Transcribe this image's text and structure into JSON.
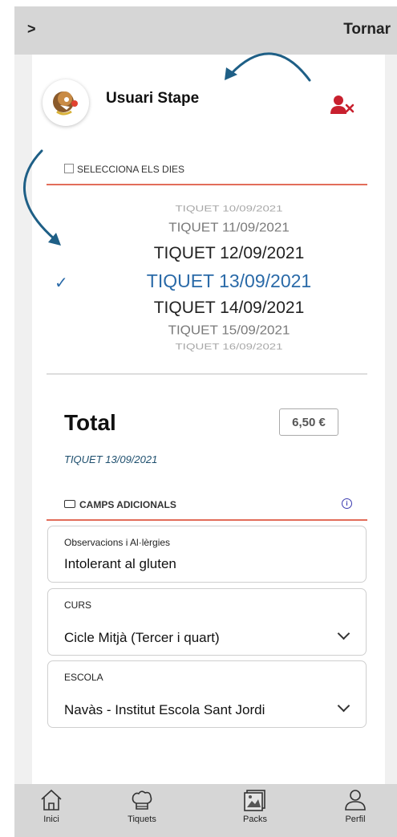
{
  "header": {
    "nav_glyph": ">",
    "back_label": "Tornar"
  },
  "user": {
    "name": "Usuari Stape"
  },
  "days_section": {
    "title": "SELECCIONA ELS DIES",
    "options": [
      "TIQUET 10/09/2021",
      "TIQUET 11/09/2021",
      "TIQUET 12/09/2021",
      "TIQUET 13/09/2021",
      "TIQUET 14/09/2021",
      "TIQUET 15/09/2021",
      "TIQUET 16/09/2021"
    ],
    "selected_index": 3
  },
  "summary": {
    "total_label": "Total",
    "price": "6,50 €",
    "selected_ticket": "TIQUET 13/09/2021"
  },
  "extra_fields": {
    "title": "CAMPS ADICIONALS",
    "observations": {
      "label": "Observacions i Al·lèrgies",
      "value": "Intolerant al gluten"
    },
    "course": {
      "label": "CURS",
      "value": "Cicle Mitjà (Tercer i quart)"
    },
    "school": {
      "label": "ESCOLA",
      "value": "Navàs - Institut Escola Sant Jordi"
    }
  },
  "tabs": [
    {
      "label": "Inici",
      "icon": "home-icon"
    },
    {
      "label": "Tiquets",
      "icon": "chef-hat-icon"
    },
    {
      "label": "Packs",
      "icon": "gallery-icon"
    },
    {
      "label": "Perfil",
      "icon": "user-icon"
    }
  ],
  "colors": {
    "accent_blue": "#2a6aa8",
    "accent_red": "#c8202e",
    "rule_red": "#e26d5a",
    "annotation_arrow": "#1e5f86"
  }
}
